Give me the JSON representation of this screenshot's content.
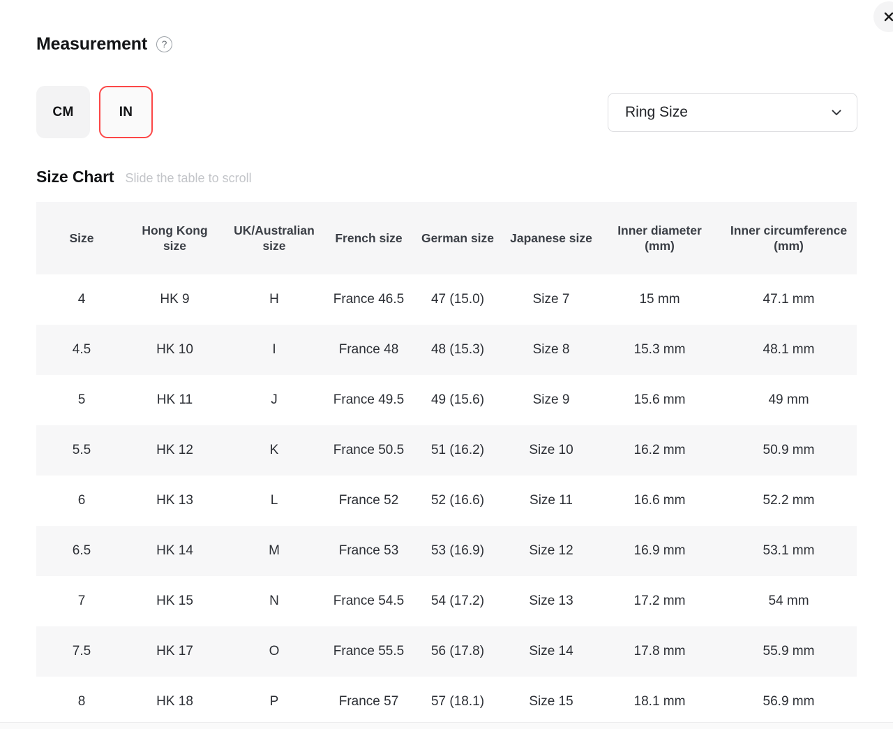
{
  "header": {
    "title": "Measurement",
    "help_icon_glyph": "?",
    "help_icon_name": "help-circle-icon",
    "close_icon_name": "close-icon"
  },
  "units": {
    "options": [
      {
        "label": "CM",
        "selected": false
      },
      {
        "label": "IN",
        "selected": true
      }
    ],
    "selected_border_color": "#FC4747",
    "unselected_bg": "#F3F3F4"
  },
  "size_selector": {
    "value": "Ring Size",
    "chevron_icon_name": "chevron-down-icon"
  },
  "chart": {
    "title": "Size Chart",
    "hint": "Slide the table to scroll"
  },
  "table": {
    "columns": [
      "Size",
      "Hong Kong size",
      "UK/Australian size",
      "French size",
      "German size",
      "Japanese size",
      "Inner diameter (mm)",
      "Inner circumference (mm)"
    ],
    "rows": [
      [
        "4",
        "HK 9",
        "H",
        "France 46.5",
        "47 (15.0)",
        "Size 7",
        "15 mm",
        "47.1 mm"
      ],
      [
        "4.5",
        "HK 10",
        "I",
        "France 48",
        "48 (15.3)",
        "Size 8",
        "15.3 mm",
        "48.1 mm"
      ],
      [
        "5",
        "HK 11",
        "J",
        "France 49.5",
        "49 (15.6)",
        "Size 9",
        "15.6 mm",
        "49 mm"
      ],
      [
        "5.5",
        "HK 12",
        "K",
        "France 50.5",
        "51 (16.2)",
        "Size 10",
        "16.2 mm",
        "50.9 mm"
      ],
      [
        "6",
        "HK 13",
        "L",
        "France 52",
        "52 (16.6)",
        "Size 11",
        "16.6 mm",
        "52.2 mm"
      ],
      [
        "6.5",
        "HK 14",
        "M",
        "France 53",
        "53 (16.9)",
        "Size 12",
        "16.9 mm",
        "53.1 mm"
      ],
      [
        "7",
        "HK 15",
        "N",
        "France 54.5",
        "54 (17.2)",
        "Size 13",
        "17.2 mm",
        "54 mm"
      ],
      [
        "7.5",
        "HK 17",
        "O",
        "France 55.5",
        "56 (17.8)",
        "Size 14",
        "17.8 mm",
        "55.9 mm"
      ],
      [
        "8",
        "HK 18",
        "P",
        "France 57",
        "57 (18.1)",
        "Size 15",
        "18.1 mm",
        "56.9 mm"
      ]
    ]
  }
}
